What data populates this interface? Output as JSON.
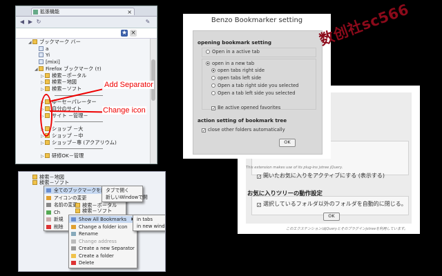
{
  "browser": {
    "tab_title": "拡張機能",
    "tree": [
      {
        "label": "ブックマーク バー",
        "kind": "folder",
        "depth": 0,
        "open": true
      },
      {
        "label": "a",
        "kind": "page",
        "depth": 1
      },
      {
        "label": "Yi",
        "kind": "page",
        "depth": 1
      },
      {
        "label": "[mixi]",
        "kind": "page",
        "depth": 1
      },
      {
        "label": "Firefox ブックマーク (†)",
        "kind": "folder",
        "depth": 1,
        "open": true
      },
      {
        "label": "検索－ポータル",
        "kind": "folder",
        "depth": 2
      },
      {
        "label": "検索－地図",
        "kind": "folder",
        "depth": 2
      },
      {
        "label": "検索－ソフト",
        "kind": "folder",
        "depth": 2
      },
      {
        "label": "",
        "kind": "separator",
        "depth": 2
      },
      {
        "label": "ゆーセーパレーター",
        "kind": "folder",
        "depth": 2
      },
      {
        "label": "自分のサイト",
        "kind": "folder",
        "depth": 2
      },
      {
        "label": "サイト －管理－",
        "kind": "folder",
        "depth": 2
      },
      {
        "label": "",
        "kind": "separator",
        "depth": 2
      },
      {
        "label": "ショップ －大",
        "kind": "folder",
        "depth": 2
      },
      {
        "label": "ショップ －中",
        "kind": "folder",
        "depth": 2
      },
      {
        "label": "ショップ－専 (アクアリウム)",
        "kind": "folder",
        "depth": 2
      },
      {
        "label": "",
        "kind": "separator",
        "depth": 2
      },
      {
        "label": "研修OK－管理",
        "kind": "folder",
        "depth": 2
      }
    ]
  },
  "annotations": {
    "add_separator": "Add Separator",
    "change_icon": "Change icon"
  },
  "context_jp": {
    "rows_bg": [
      "検索－地図",
      "検索－ソフト"
    ],
    "items": [
      {
        "label": "全てのブックマークを開く",
        "highlight": true,
        "submenu": true
      },
      {
        "label": "アイコンの変更"
      },
      {
        "label": "名前の変更"
      },
      {
        "label": "Ch"
      },
      {
        "label": "新規"
      },
      {
        "label": "削除"
      }
    ],
    "sub_items": [
      "タブで開く",
      "新しいWindowで開"
    ]
  },
  "context_en": {
    "rows_bg": [
      "検索－ポータル",
      "検索－ソフト"
    ],
    "items": [
      {
        "label": "Show All Bookmarks",
        "highlight": true,
        "submenu": true
      },
      {
        "label": "Change a folder icon"
      },
      {
        "label": "Rename"
      },
      {
        "label": "Change address",
        "disabled": true
      },
      {
        "label": "Create a new Separator"
      },
      {
        "label": "Create a folder"
      },
      {
        "label": "Delete"
      }
    ],
    "sub_items": [
      "in tabs",
      "in new windows"
    ]
  },
  "settings_en": {
    "title": "Benzo Bookmarker setting",
    "section1": "opening bookmark setting",
    "open_active": "Open in a active tab",
    "open_new": "open in a new tab",
    "sub_options": [
      "open tabs right side",
      "open tabs left side",
      "Open a tab right side you selected",
      "Open a tab left side you selected"
    ],
    "be_active": "Be active opened favorites",
    "section2": "action setting of bookmark tree",
    "close_other": "close other folders automatically",
    "ok": "OK"
  },
  "settings_jp": {
    "note_top": "This extension makes use of its plug-ins jstree jQuery.",
    "opened_active": "開いたお気に入りをアクティブにする (表示する)",
    "section": "お気に入りツリーの動作設定",
    "close_other": "選択しているフォルダ以外のフォルダを自動的に閉じる。",
    "ok": "OK",
    "note_bottom": "このエクステンションはjQueryとそのプラグインjstreeを利用しています。"
  },
  "watermark": "数创社sc566",
  "colors": {
    "annotation_red": "#e00000",
    "watermark_red": "#8b0a1a",
    "menu_highlight": "#c7d9f2"
  }
}
